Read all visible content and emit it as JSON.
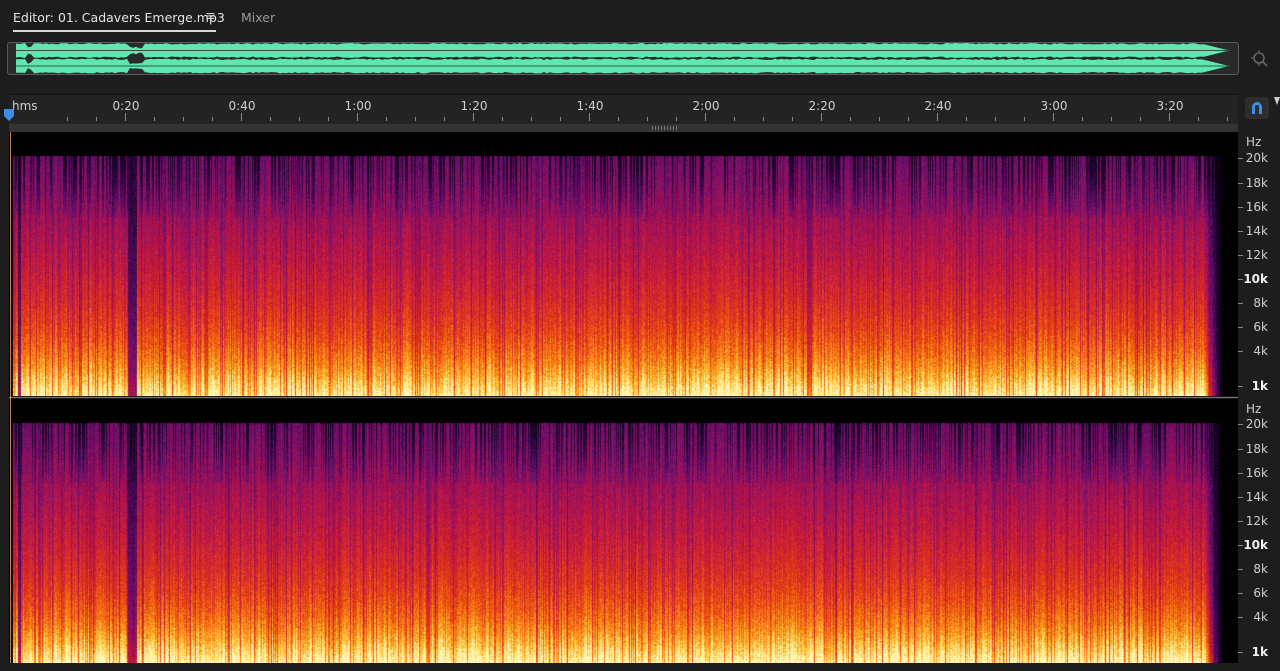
{
  "tabs": {
    "editor_label": "Editor: 01. Cadavers Emerge.mp3",
    "menu_glyph": "≡",
    "mixer_label": "Mixer"
  },
  "overview": {
    "waveform_color": "#5ee8b0"
  },
  "timeline": {
    "ticks": [
      "hms",
      "0:20",
      "0:40",
      "1:00",
      "1:20",
      "1:40",
      "2:00",
      "2:20",
      "2:40",
      "3:00",
      "3:20"
    ]
  },
  "icons": {
    "zoom": "zoom-magnifier-icon",
    "snap": "magnet-icon",
    "playhead": "playhead-marker-icon"
  },
  "channels": [
    {
      "unit": "Hz",
      "labels": [
        "20k",
        "18k",
        "16k",
        "14k",
        "12k",
        "10k",
        "8k",
        "6k",
        "4k",
        "1k"
      ]
    },
    {
      "unit": "Hz",
      "labels": [
        "20k",
        "18k",
        "16k",
        "14k",
        "12k",
        "10k",
        "8k",
        "6k",
        "4k",
        "1k"
      ]
    }
  ],
  "colors": {
    "background": "#1d1d1d",
    "waveform": "#5ee8b0",
    "playhead": "#3a8ee8"
  }
}
